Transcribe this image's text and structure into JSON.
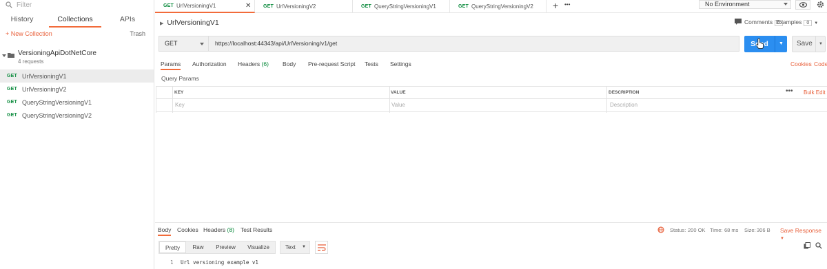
{
  "sidebar": {
    "filter_placeholder": "Filter",
    "tabs": [
      "History",
      "Collections",
      "APIs"
    ],
    "new_collection": "+ New Collection",
    "trash": "Trash",
    "collection": {
      "name": "VersioningApiDotNetCore",
      "count": "4 requests"
    },
    "requests": [
      {
        "method": "GET",
        "name": "UrlVersioningV1"
      },
      {
        "method": "GET",
        "name": "UrlVersioningV2"
      },
      {
        "method": "GET",
        "name": "QueryStringVersioningV1"
      },
      {
        "method": "GET",
        "name": "QueryStringVersioningV2"
      }
    ]
  },
  "tabs": [
    {
      "method": "GET",
      "name": "UrlVersioningV1"
    },
    {
      "method": "GET",
      "name": "UrlVersioningV2"
    },
    {
      "method": "GET",
      "name": "QueryStringVersioningV1"
    },
    {
      "method": "GET",
      "name": "QueryStringVersioningV2"
    }
  ],
  "tabbar": {
    "add": "+",
    "more": "•••"
  },
  "environment": "No Environment",
  "request": {
    "title": "UrlVersioningV1",
    "comments_label": "Comments",
    "comments_count": "0",
    "examples_label": "Examples",
    "examples_count": "0",
    "method": "GET",
    "url": "https://localhost:44343/api/UrlVersioning/v1/get",
    "send": "Send",
    "save": "Save"
  },
  "param_tabs": {
    "params": "Params",
    "authorization": "Authorization",
    "headers": "Headers",
    "headers_count": "(6)",
    "body": "Body",
    "prerequest": "Pre-request Script",
    "tests": "Tests",
    "settings": "Settings",
    "cookies": "Cookies",
    "code": "Code"
  },
  "query_params": {
    "label": "Query Params",
    "headers": [
      "KEY",
      "VALUE",
      "DESCRIPTION"
    ],
    "placeholders": [
      "Key",
      "Value",
      "Description"
    ],
    "more": "•••",
    "bulk_edit": "Bulk Edit"
  },
  "response": {
    "tabs": {
      "body": "Body",
      "cookies": "Cookies",
      "headers": "Headers",
      "headers_count": "(8)",
      "test_results": "Test Results"
    },
    "status_label": "Status:",
    "status_value": "200 OK",
    "time_label": "Time:",
    "time_value": "68 ms",
    "size_label": "Size:",
    "size_value": "306 B",
    "save_response": "Save Response",
    "views": [
      "Pretty",
      "Raw",
      "Preview",
      "Visualize"
    ],
    "format": "Text",
    "line_number": "1",
    "body_text": "Url versioning example v1"
  },
  "colors": {
    "accent": "#f26b3a",
    "send": "#2b8ef0",
    "get": "#0a8a3c",
    "status_ok": "#0a8a3c"
  }
}
